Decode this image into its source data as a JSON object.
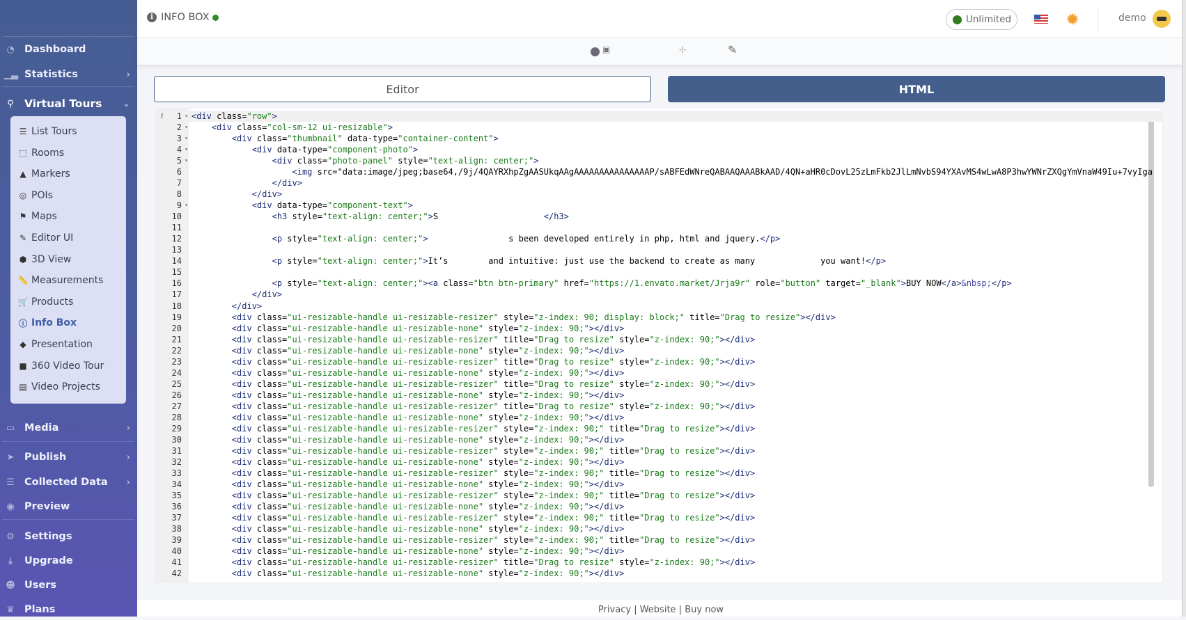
{
  "header": {
    "title": "INFO BOX",
    "plan_badge": "Unlimited",
    "user": "demo"
  },
  "sidebar": {
    "items": [
      {
        "label": "Dashboard",
        "icon": "dashboard-icon"
      },
      {
        "label": "Statistics",
        "icon": "chart-icon",
        "chevron": true
      },
      {
        "label": "Virtual Tours",
        "icon": "route-icon",
        "chevron": true,
        "active": true
      },
      {
        "label": "Media",
        "icon": "monitor-icon",
        "chevron": true
      },
      {
        "label": "Publish",
        "icon": "paper-plane-icon",
        "chevron": true
      },
      {
        "label": "Collected Data",
        "icon": "database-icon",
        "chevron": true
      },
      {
        "label": "Preview",
        "icon": "eye-icon"
      },
      {
        "label": "Settings",
        "icon": "gears-icon"
      },
      {
        "label": "Upgrade",
        "icon": "download-icon"
      },
      {
        "label": "Users",
        "icon": "users-icon"
      },
      {
        "label": "Plans",
        "icon": "crown-icon"
      }
    ],
    "submenu": [
      {
        "label": "List Tours",
        "icon": "list-icon"
      },
      {
        "label": "Rooms",
        "icon": "vector-square-icon"
      },
      {
        "label": "Markers",
        "icon": "marker-icon"
      },
      {
        "label": "POIs",
        "icon": "bullseye-icon"
      },
      {
        "label": "Maps",
        "icon": "map-icon"
      },
      {
        "label": "Editor UI",
        "icon": "edit-ui-icon"
      },
      {
        "label": "3D View",
        "icon": "cube-icon"
      },
      {
        "label": "Measurements",
        "icon": "ruler-icon"
      },
      {
        "label": "Products",
        "icon": "cart-icon"
      },
      {
        "label": "Info Box",
        "icon": "info-circle-icon",
        "active": true
      },
      {
        "label": "Presentation",
        "icon": "diamond-icon"
      },
      {
        "label": "360 Video Tour",
        "icon": "video-icon"
      },
      {
        "label": "Video Projects",
        "icon": "film-icon"
      }
    ]
  },
  "tabs": {
    "editor": "Editor",
    "html": "HTML"
  },
  "colors": {
    "sidebar_top": "#465d93",
    "sidebar_bottom": "#5a55b2",
    "accent": "#455f8c",
    "status_green": "#2e8b2e"
  },
  "code": {
    "lines": [
      "<div class=\"row\">",
      "    <div class=\"col-sm-12 ui-resizable\">",
      "        <div class=\"thumbnail\" data-type=\"container-content\">",
      "            <div data-type=\"component-photo\">",
      "                <div class=\"photo-panel\" style=\"text-align: center;\">",
      "                    <img src=\"data:image/jpeg;base64,/9j/4QAYRXhpZgAASUkqAAgAAAAAAAAAAAAAAAP/sABFEdWNreQABAAQAAABkAAD/4QN+aHR0cDovL25zLmFkb2JlLmNvbS94YXAvMS4wLwA8P3hwYWNrZXQgYmVnaW49Iu+7vyIga",
      "                </div>",
      "            </div>",
      "            <div data-type=\"component-text\">",
      "                <h3 style=\"text-align: center;\">S                     </h3>",
      "",
      "                <p style=\"text-align: center;\">                s been developed entirely in php, html and jquery.</p>",
      "",
      "                <p style=\"text-align: center;\">It’s        and intuitive: just use the backend to create as many             you want!</p>",
      "",
      "                <p style=\"text-align: center;\"><a class=\"btn btn-primary\" href=\"https://1.envato.market/Jrja9r\" role=\"button\" target=\"_blank\">BUY NOW</a>&nbsp;</p>",
      "            </div>",
      "        </div>",
      "        <div class=\"ui-resizable-handle ui-resizable-resizer\" style=\"z-index: 90; display: block;\" title=\"Drag to resize\"></div>",
      "        <div class=\"ui-resizable-handle ui-resizable-none\" style=\"z-index: 90;\"></div>",
      "        <div class=\"ui-resizable-handle ui-resizable-resizer\" title=\"Drag to resize\" style=\"z-index: 90;\"></div>",
      "        <div class=\"ui-resizable-handle ui-resizable-none\" style=\"z-index: 90;\"></div>",
      "        <div class=\"ui-resizable-handle ui-resizable-resizer\" title=\"Drag to resize\" style=\"z-index: 90;\"></div>",
      "        <div class=\"ui-resizable-handle ui-resizable-none\" style=\"z-index: 90;\"></div>",
      "        <div class=\"ui-resizable-handle ui-resizable-resizer\" title=\"Drag to resize\" style=\"z-index: 90;\"></div>",
      "        <div class=\"ui-resizable-handle ui-resizable-none\" style=\"z-index: 90;\"></div>",
      "        <div class=\"ui-resizable-handle ui-resizable-resizer\" title=\"Drag to resize\" style=\"z-index: 90;\"></div>",
      "        <div class=\"ui-resizable-handle ui-resizable-none\" style=\"z-index: 90;\"></div>",
      "        <div class=\"ui-resizable-handle ui-resizable-resizer\" style=\"z-index: 90;\" title=\"Drag to resize\"></div>",
      "        <div class=\"ui-resizable-handle ui-resizable-none\" style=\"z-index: 90;\"></div>",
      "        <div class=\"ui-resizable-handle ui-resizable-resizer\" style=\"z-index: 90;\" title=\"Drag to resize\"></div>",
      "        <div class=\"ui-resizable-handle ui-resizable-none\" style=\"z-index: 90;\"></div>",
      "        <div class=\"ui-resizable-handle ui-resizable-resizer\" style=\"z-index: 90;\" title=\"Drag to resize\"></div>",
      "        <div class=\"ui-resizable-handle ui-resizable-none\" style=\"z-index: 90;\"></div>",
      "        <div class=\"ui-resizable-handle ui-resizable-resizer\" style=\"z-index: 90;\" title=\"Drag to resize\"></div>",
      "        <div class=\"ui-resizable-handle ui-resizable-none\" style=\"z-index: 90;\"></div>",
      "        <div class=\"ui-resizable-handle ui-resizable-resizer\" style=\"z-index: 90;\" title=\"Drag to resize\"></div>",
      "        <div class=\"ui-resizable-handle ui-resizable-none\" style=\"z-index: 90;\"></div>",
      "        <div class=\"ui-resizable-handle ui-resizable-resizer\" style=\"z-index: 90;\" title=\"Drag to resize\"></div>",
      "        <div class=\"ui-resizable-handle ui-resizable-none\" style=\"z-index: 90;\"></div>",
      "        <div class=\"ui-resizable-handle ui-resizable-resizer\" title=\"Drag to resize\" style=\"z-index: 90;\"></div>",
      "        <div class=\"ui-resizable-handle ui-resizable-none\" style=\"z-index: 90;\"></div>"
    ],
    "fold_lines": [
      1,
      2,
      3,
      4,
      5,
      9
    ]
  },
  "footer": {
    "links": [
      "Privacy",
      "Website",
      "Buy now"
    ],
    "separator": "|"
  }
}
